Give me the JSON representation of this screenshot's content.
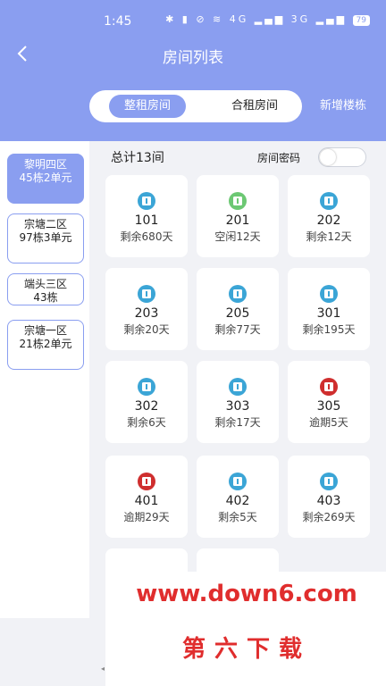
{
  "status_bar": {
    "time": "1:45",
    "icons": "✱ ▮ ⊘ ≋ 4G ▂▄▆ 3G ▂▄▆",
    "battery": "79"
  },
  "header": {
    "back_icon": "chevron-left-icon",
    "title": "房间列表"
  },
  "tabs": {
    "whole": "整租房间",
    "shared": "合租房间",
    "add_building": "新增楼栋"
  },
  "sidebar": [
    {
      "label": "黎明四区\n45栋2单元",
      "active": true
    },
    {
      "label": "宗塘二区\n97栋3单元",
      "active": false
    },
    {
      "label": "端头三区\n43栋",
      "active": false
    },
    {
      "label": "宗塘一区\n21栋2单元",
      "active": false
    }
  ],
  "summary": {
    "total": "总计13间",
    "password_label": "房间密码",
    "password_toggle": false
  },
  "colors": {
    "accent": "#8a9ef0",
    "normal": "#3ba5d6",
    "vacant": "#6cc873",
    "overdue": "#cf2e2e"
  },
  "rooms": [
    {
      "number": "101",
      "status": "剩余680天",
      "kind": "normal"
    },
    {
      "number": "201",
      "status": "空闲12天",
      "kind": "vacant"
    },
    {
      "number": "202",
      "status": "剩余12天",
      "kind": "normal"
    },
    {
      "number": "203",
      "status": "剩余20天",
      "kind": "normal"
    },
    {
      "number": "205",
      "status": "剩余77天",
      "kind": "normal"
    },
    {
      "number": "301",
      "status": "剩余195天",
      "kind": "normal"
    },
    {
      "number": "302",
      "status": "剩余6天",
      "kind": "normal"
    },
    {
      "number": "303",
      "status": "剩余17天",
      "kind": "normal"
    },
    {
      "number": "305",
      "status": "逾期5天",
      "kind": "overdue"
    },
    {
      "number": "401",
      "status": "逾期29天",
      "kind": "overdue"
    },
    {
      "number": "402",
      "status": "剩余5天",
      "kind": "normal"
    },
    {
      "number": "403",
      "status": "剩余269天",
      "kind": "normal"
    }
  ],
  "watermark": {
    "url": "www.down6.com",
    "name": "第六下载"
  }
}
